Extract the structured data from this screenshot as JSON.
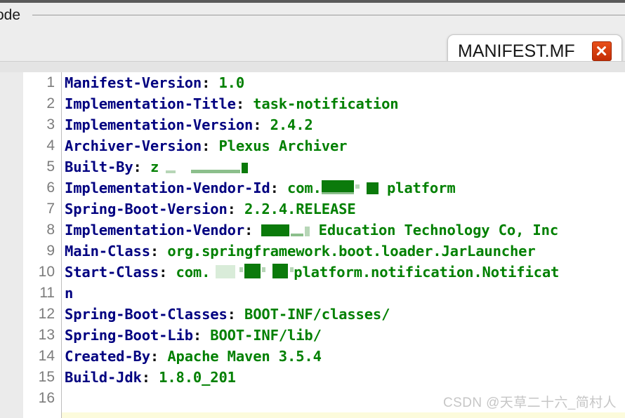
{
  "window": {
    "group_label": "ode",
    "background_color": "#ededed"
  },
  "tab": {
    "label": "MANIFEST.MF",
    "close_icon": "close-x-icon",
    "close_color": "#d1390b"
  },
  "editor": {
    "key_color": "#000080",
    "value_color": "#008000",
    "lineno_color": "#7c7c7c",
    "highlight_color": "#fcfbdc",
    "lines": [
      {
        "no": "1",
        "key": "Manifest-Version",
        "sep": ": ",
        "value": "1.0"
      },
      {
        "no": "2",
        "key": "Implementation-Title",
        "sep": ": ",
        "value": "task-notification"
      },
      {
        "no": "3",
        "key": "Implementation-Version",
        "sep": ": ",
        "value": "2.4.2"
      },
      {
        "no": "4",
        "key": "Archiver-Version",
        "sep": ": ",
        "value": "Plexus Archiver"
      },
      {
        "no": "5",
        "key": "Built-By",
        "sep": ": ",
        "value": "z",
        "value_after": "",
        "redacted": true
      },
      {
        "no": "6",
        "key": "Implementation-Vendor-Id",
        "sep": ": ",
        "value": "com.",
        "value_after": " platform",
        "redacted": true
      },
      {
        "no": "7",
        "key": "Spring-Boot-Version",
        "sep": ": ",
        "value": "2.2.4.RELEASE"
      },
      {
        "no": "8",
        "key": "Implementation-Vendor",
        "sep": ": ",
        "value": "",
        "value_after": " Education Technology Co, Inc",
        "redacted": true
      },
      {
        "no": "9",
        "key": "Main-Class",
        "sep": ": ",
        "value": "org.springframework.boot.loader.JarLauncher"
      },
      {
        "no": "10",
        "key": "Start-Class",
        "sep": ": ",
        "value": "com.",
        "value_after": "platform.notification.Notificat",
        "redacted": true
      },
      {
        "no": "11",
        "key": "",
        "sep": "",
        "value": "",
        "continuation": " n"
      },
      {
        "no": "12",
        "key": "Spring-Boot-Classes",
        "sep": ": ",
        "value": "BOOT-INF/classes/"
      },
      {
        "no": "13",
        "key": "Spring-Boot-Lib",
        "sep": ": ",
        "value": "BOOT-INF/lib/"
      },
      {
        "no": "14",
        "key": "Created-By",
        "sep": ": ",
        "value": "Apache Maven 3.5.4"
      },
      {
        "no": "15",
        "key": "Build-Jdk",
        "sep": ": ",
        "value": "1.8.0_201"
      },
      {
        "no": "16",
        "key": "",
        "sep": "",
        "value": ""
      }
    ]
  },
  "watermark": {
    "text": "CSDN @天草二十六_简村人"
  }
}
